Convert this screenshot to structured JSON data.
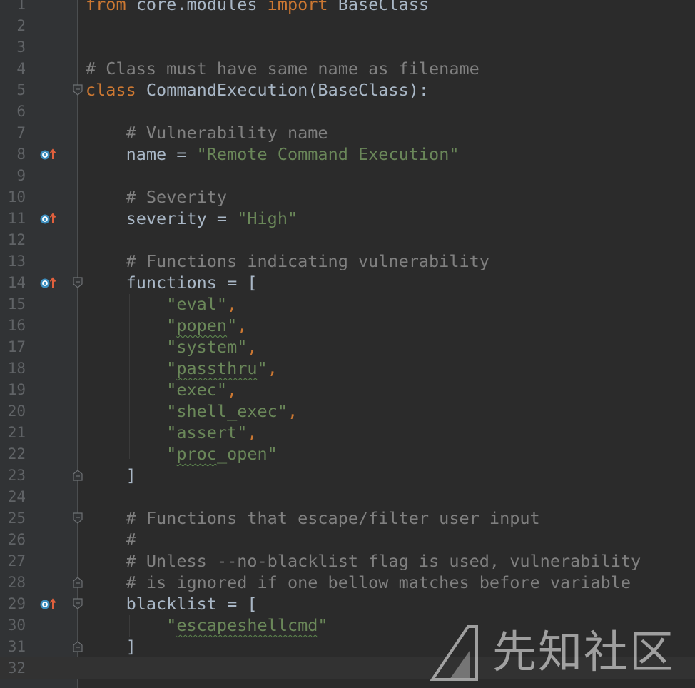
{
  "editor": {
    "lines": [
      {
        "n": "1",
        "tokens": [
          {
            "t": "from",
            "c": "kw"
          },
          {
            "t": " core.modules ",
            "c": "nm"
          },
          {
            "t": "import",
            "c": "kw"
          },
          {
            "t": " BaseClass",
            "c": "nm"
          }
        ]
      },
      {
        "n": "2",
        "tokens": []
      },
      {
        "n": "3",
        "tokens": []
      },
      {
        "n": "4",
        "tokens": [
          {
            "t": "# Class must have same name as filename",
            "c": "cm"
          }
        ]
      },
      {
        "n": "5",
        "fold": "open",
        "tokens": [
          {
            "t": "class",
            "c": "kw"
          },
          {
            "t": " CommandExecution(BaseClass):",
            "c": "cl"
          }
        ]
      },
      {
        "n": "6",
        "tokens": []
      },
      {
        "n": "7",
        "tokens": [
          {
            "t": "    # Vulnerability name",
            "c": "cm"
          }
        ]
      },
      {
        "n": "8",
        "marker": true,
        "tokens": [
          {
            "t": "    name = ",
            "c": "nm"
          },
          {
            "t": "\"Remote Command Execution\"",
            "c": "st"
          }
        ]
      },
      {
        "n": "9",
        "tokens": []
      },
      {
        "n": "10",
        "tokens": [
          {
            "t": "    # Severity",
            "c": "cm"
          }
        ]
      },
      {
        "n": "11",
        "marker": true,
        "tokens": [
          {
            "t": "    severity = ",
            "c": "nm"
          },
          {
            "t": "\"High\"",
            "c": "st"
          }
        ]
      },
      {
        "n": "12",
        "tokens": []
      },
      {
        "n": "13",
        "tokens": [
          {
            "t": "    # Functions indicating vulnerability",
            "c": "cm"
          }
        ]
      },
      {
        "n": "14",
        "marker": true,
        "fold": "open",
        "tokens": [
          {
            "t": "    functions = [",
            "c": "nm"
          }
        ]
      },
      {
        "n": "15",
        "tokens": [
          {
            "t": "        ",
            "c": "nm"
          },
          {
            "t": "\"eval\"",
            "c": "st"
          },
          {
            "t": ",",
            "c": "kw"
          }
        ]
      },
      {
        "n": "16",
        "tokens": [
          {
            "t": "        \"",
            "c": "st"
          },
          {
            "t": "popen",
            "c": "st",
            "u": true
          },
          {
            "t": "\"",
            "c": "st"
          },
          {
            "t": ",",
            "c": "kw"
          }
        ]
      },
      {
        "n": "17",
        "tokens": [
          {
            "t": "        ",
            "c": "nm"
          },
          {
            "t": "\"system\"",
            "c": "st"
          },
          {
            "t": ",",
            "c": "kw"
          }
        ]
      },
      {
        "n": "18",
        "tokens": [
          {
            "t": "        \"",
            "c": "st"
          },
          {
            "t": "passthru",
            "c": "st",
            "u": true
          },
          {
            "t": "\"",
            "c": "st"
          },
          {
            "t": ",",
            "c": "kw"
          }
        ]
      },
      {
        "n": "19",
        "tokens": [
          {
            "t": "        ",
            "c": "nm"
          },
          {
            "t": "\"exec\"",
            "c": "st"
          },
          {
            "t": ",",
            "c": "kw"
          }
        ]
      },
      {
        "n": "20",
        "tokens": [
          {
            "t": "        ",
            "c": "nm"
          },
          {
            "t": "\"shell_exec\"",
            "c": "st"
          },
          {
            "t": ",",
            "c": "kw"
          }
        ]
      },
      {
        "n": "21",
        "tokens": [
          {
            "t": "        ",
            "c": "nm"
          },
          {
            "t": "\"assert\"",
            "c": "st"
          },
          {
            "t": ",",
            "c": "kw"
          }
        ]
      },
      {
        "n": "22",
        "tokens": [
          {
            "t": "        \"",
            "c": "st"
          },
          {
            "t": "proc",
            "c": "st",
            "u": true
          },
          {
            "t": "_open\"",
            "c": "st"
          }
        ]
      },
      {
        "n": "23",
        "fold": "close",
        "tokens": [
          {
            "t": "    ]",
            "c": "nm"
          }
        ]
      },
      {
        "n": "24",
        "tokens": []
      },
      {
        "n": "25",
        "fold": "open",
        "tokens": [
          {
            "t": "    # Functions that escape/filter user input",
            "c": "cm"
          }
        ]
      },
      {
        "n": "26",
        "tokens": [
          {
            "t": "    #",
            "c": "cm"
          }
        ]
      },
      {
        "n": "27",
        "tokens": [
          {
            "t": "    # Unless --no-blacklist flag is used, vulnerability",
            "c": "cm"
          }
        ]
      },
      {
        "n": "28",
        "fold": "close",
        "tokens": [
          {
            "t": "    # is ignored if one bellow matches before variable",
            "c": "cm"
          }
        ]
      },
      {
        "n": "29",
        "marker": true,
        "fold": "open",
        "tokens": [
          {
            "t": "    blacklist = [",
            "c": "nm"
          }
        ]
      },
      {
        "n": "30",
        "tokens": [
          {
            "t": "        \"",
            "c": "st"
          },
          {
            "t": "escapeshellcmd",
            "c": "st",
            "u": true
          },
          {
            "t": "\"",
            "c": "st"
          }
        ]
      },
      {
        "n": "31",
        "fold": "close",
        "tokens": [
          {
            "t": "    ]",
            "c": "nm"
          }
        ]
      },
      {
        "n": "32",
        "current": true,
        "tokens": []
      }
    ]
  },
  "icons": {
    "marker": "override-method-icon",
    "fold_open": "fold-collapse-icon",
    "fold_close": "fold-end-icon"
  },
  "colors": {
    "background": "#2b2b2b",
    "gutter": "#313335",
    "keyword": "#cc7832",
    "comment": "#808080",
    "string": "#6a8759",
    "identifier": "#a9b7c6",
    "line_number": "#606366",
    "marker_circle": "#3d8fbf",
    "marker_arrow": "#e0603d"
  },
  "watermark": {
    "text": "先知社区",
    "logo_icon": "xianzhi-logo-icon"
  }
}
